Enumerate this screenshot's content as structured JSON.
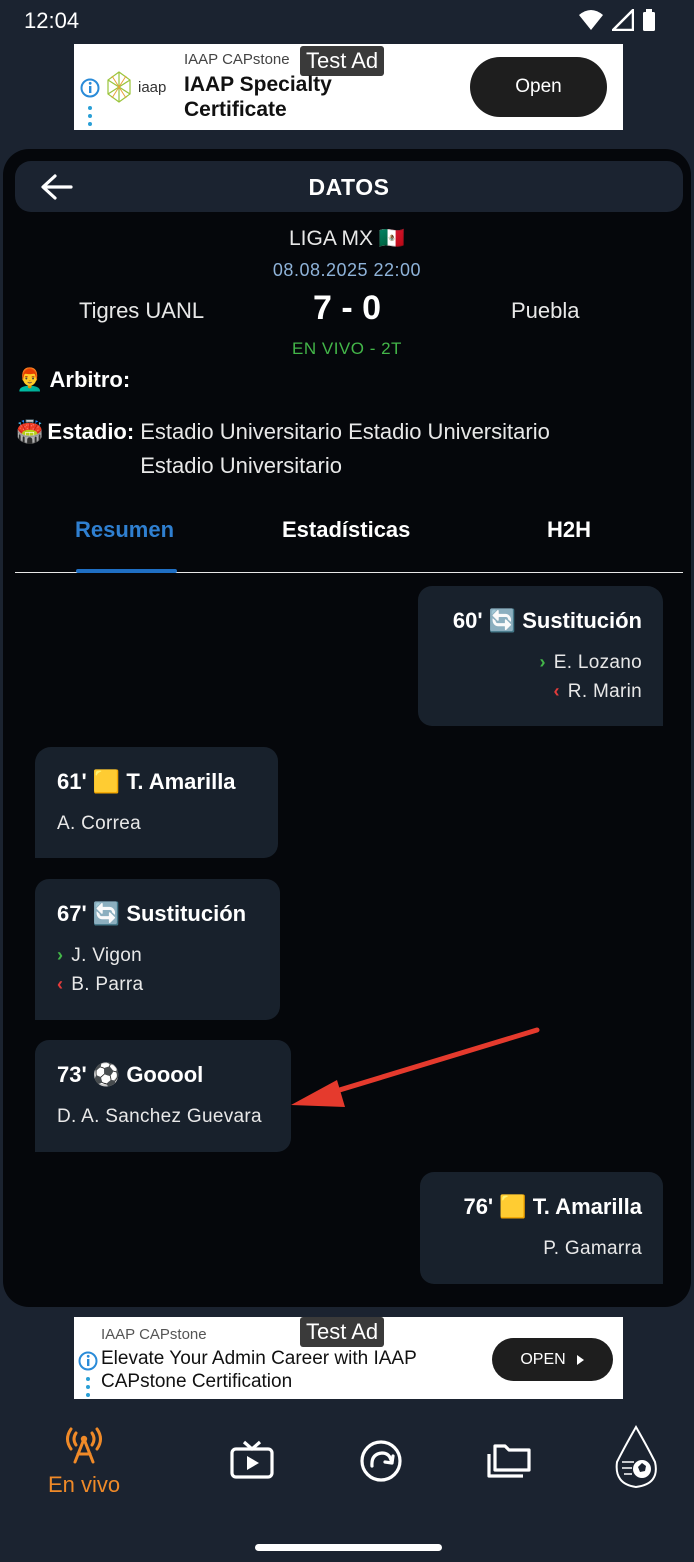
{
  "status_bar": {
    "time": "12:04"
  },
  "ad_top": {
    "badge": "Test Ad",
    "advertiser": "IAAP CAPstone",
    "logo_text": "iaap",
    "headline": "IAAP Specialty Certificate",
    "cta": "Open"
  },
  "header": {
    "title": "DATOS",
    "back_icon": "arrow-left-icon"
  },
  "match": {
    "league": "LIGA MX 🇲🇽",
    "datetime": "08.08.2025 22:00",
    "home_team": "Tigres UANL",
    "score": "7 - 0",
    "away_team": "Puebla",
    "status": "EN VIVO - 2T"
  },
  "info": {
    "referee_emoji": "👨‍🦰",
    "referee_label": "Arbitro:",
    "referee_value": "",
    "stadium_emoji": "🏟️",
    "stadium_label": "Estadio:",
    "stadium_value": "Estadio Universitario Estadio Universitario Estadio Universitario"
  },
  "tabs": [
    {
      "label": "Resumen",
      "active": true
    },
    {
      "label": "Estadísticas",
      "active": false
    },
    {
      "label": "H2H",
      "active": false
    }
  ],
  "events": [
    {
      "side": "right",
      "title": "60' 🔄 Sustitución",
      "in": "E. Lozano",
      "out": "R. Marin"
    },
    {
      "side": "left",
      "title": "61' 🟨 T. Amarilla",
      "player": "A. Correa"
    },
    {
      "side": "left",
      "title": "67' 🔄 Sustitución",
      "in": "J. Vigon",
      "out": "B. Parra"
    },
    {
      "side": "left",
      "title": "73' ⚽ Gooool",
      "player": "D. A. Sanchez Guevara"
    },
    {
      "side": "right",
      "title": "76' 🟨 T. Amarilla",
      "player": "P. Gamarra"
    }
  ],
  "ad_bottom": {
    "badge": "Test Ad",
    "advertiser": "IAAP CAPstone",
    "headline": "Elevate Your Admin Career with IAAP CAPstone Certification",
    "cta": "OPEN"
  },
  "bottom_nav": [
    {
      "label": "En vivo",
      "icon": "broadcast-icon",
      "active": true,
      "color": "#f08a28"
    },
    {
      "label": "",
      "icon": "tv-play-icon",
      "active": false
    },
    {
      "label": "",
      "icon": "replay-icon",
      "active": false
    },
    {
      "label": "",
      "icon": "folders-icon",
      "active": false
    },
    {
      "label": "",
      "icon": "app-logo-icon",
      "active": false
    }
  ],
  "colors": {
    "background": "#1b2330",
    "panel": "#05070b",
    "card": "#18212c",
    "accent_blue": "#2f7fd0",
    "live_green": "#43b649",
    "nav_active": "#f08a28",
    "sub_out_red": "#e23b3b"
  }
}
